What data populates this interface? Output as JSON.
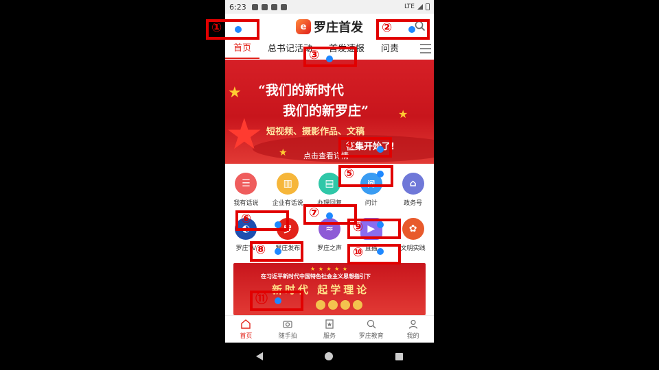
{
  "status_bar": {
    "time": "6:23",
    "network": "LTE"
  },
  "header": {
    "logo_glyph": "e",
    "title": "罗庄首发",
    "search_icon": "search-icon"
  },
  "tabs": [
    {
      "label": "首页",
      "active": true
    },
    {
      "label": "总书记活动",
      "active": false
    },
    {
      "label": "首发速报",
      "active": false
    },
    {
      "label": "问责",
      "active": false
    }
  ],
  "banner": {
    "line1": "“我们的新时代",
    "line2": "我们的新罗庄”",
    "line3": "短视频、摄影作品、文稿",
    "line4": "征集开始了!",
    "line5": "点击查看详情"
  },
  "grid_row1": [
    {
      "label": "我有话说",
      "glyph": "☰",
      "color": "#ef5d5d"
    },
    {
      "label": "企业有话说",
      "glyph": "▥",
      "color": "#f6b63a"
    },
    {
      "label": "办理回复",
      "glyph": "▤",
      "color": "#2fc7a8"
    },
    {
      "label": "问计",
      "glyph": "问",
      "color": "#3a9cf2"
    },
    {
      "label": "政务号",
      "glyph": "⌂",
      "color": "#6f78d8"
    }
  ],
  "grid_row2": [
    {
      "label": "罗庄TV",
      "glyph": "◐",
      "color": "#1e4fb0"
    },
    {
      "label": "罗庄发布",
      "glyph": "罗",
      "color": "#e2231a"
    },
    {
      "label": "罗庄之声",
      "glyph": "≈",
      "color": "#8e5bd6"
    },
    {
      "label": "直播",
      "glyph": "▶",
      "color": "#8a6df0"
    },
    {
      "label": "文明实践",
      "glyph": "✿",
      "color": "#e85a2c"
    }
  ],
  "poster": {
    "stars": "★ ★ ★ ★ ★",
    "line1": "在习近平新时代中国特色社会主义思想指引下",
    "line2": "新时代 起学理论"
  },
  "bottom_nav": [
    {
      "label": "首页",
      "active": true,
      "icon": "home-icon"
    },
    {
      "label": "随手拍",
      "active": false,
      "icon": "camera-icon"
    },
    {
      "label": "服务",
      "active": false,
      "icon": "star-icon"
    },
    {
      "label": "罗庄教育",
      "active": false,
      "icon": "education-icon"
    },
    {
      "label": "我的",
      "active": false,
      "icon": "user-icon"
    }
  ],
  "markers": [
    {
      "label": "①"
    },
    {
      "label": "②"
    },
    {
      "label": "③"
    },
    {
      "label": "④"
    },
    {
      "label": "⑤"
    },
    {
      "label": "⑥"
    },
    {
      "label": "⑦"
    },
    {
      "label": "⑧"
    },
    {
      "label": "⑨"
    },
    {
      "label": "⑩"
    },
    {
      "label": "⑪"
    }
  ],
  "colors": {
    "accent": "#e2231a",
    "marker": "#e10000",
    "dot": "#1e88ff"
  }
}
